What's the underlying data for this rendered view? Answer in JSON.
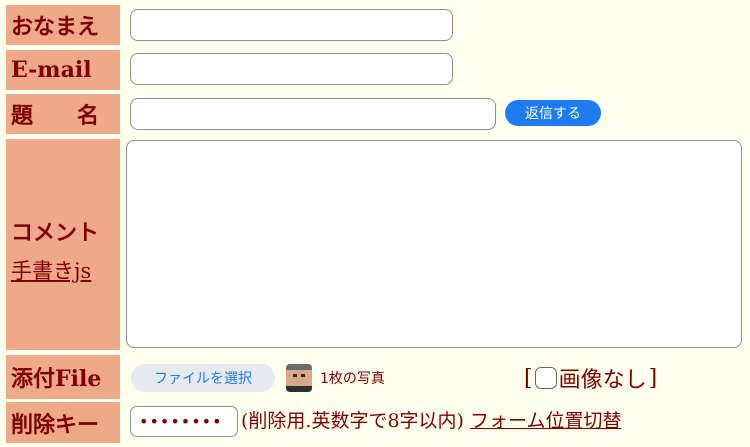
{
  "form": {
    "name": {
      "label": "おなまえ",
      "value": ""
    },
    "email": {
      "label": "E-mail",
      "value": ""
    },
    "subject": {
      "label": "題　　名",
      "value": "",
      "submit_label": "返信する"
    },
    "comment": {
      "label": "コメント",
      "link": "手書きjs",
      "value": ""
    },
    "file": {
      "label": "添付File",
      "button_label": "ファイルを選択",
      "selected_text": "1枚の写真",
      "no_image_label": "画像なし",
      "no_image_checked": false
    },
    "delete_key": {
      "label": "削除キー",
      "value": "••••••••",
      "note": "(削除用.英数字で8字以内)",
      "toggle_link": "フォーム位置切替"
    }
  },
  "colors": {
    "label_bg": "#EEAA88",
    "text": "#800000",
    "page_bg": "#FFFFEE",
    "accent": "#1E7BF2"
  }
}
